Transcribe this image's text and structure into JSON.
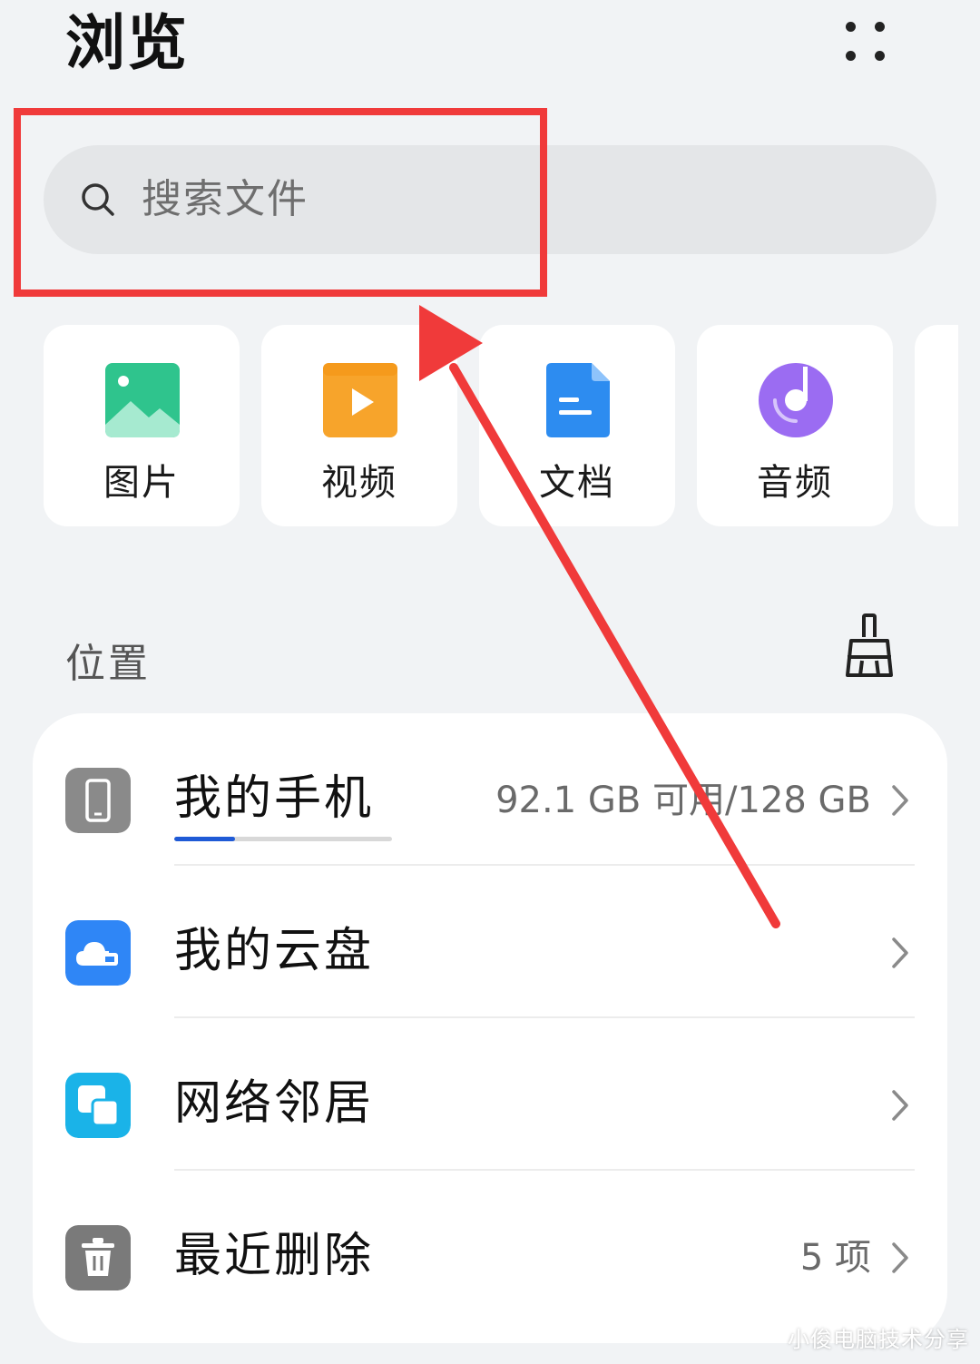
{
  "header": {
    "title": "浏览",
    "more_icon": "more-dots-icon"
  },
  "search": {
    "placeholder": "搜索文件",
    "icon": "search-icon"
  },
  "categories": [
    {
      "label": "图片",
      "icon": "image-icon",
      "color": "#2fc48d"
    },
    {
      "label": "视频",
      "icon": "video-icon",
      "color": "#f7a42b"
    },
    {
      "label": "文档",
      "icon": "document-icon",
      "color": "#2d8cf0"
    },
    {
      "label": "音频",
      "icon": "audio-icon",
      "color": "#9b6cf2"
    }
  ],
  "locations": {
    "title": "位置",
    "clean_icon": "broom-icon",
    "items": [
      {
        "label": "我的手机",
        "meta": "92.1 GB 可用/128 GB",
        "icon": "phone-icon",
        "icon_color": "#8a8a8a",
        "storage_used_fraction": 0.28
      },
      {
        "label": "我的云盘",
        "meta": "",
        "icon": "cloud-icon",
        "icon_color": "#2f86f6"
      },
      {
        "label": "网络邻居",
        "meta": "",
        "icon": "network-icon",
        "icon_color": "#1ab3e8"
      },
      {
        "label": "最近删除",
        "meta": "5 项",
        "icon": "trash-icon",
        "icon_color": "#7a7a7a"
      }
    ]
  },
  "annotation": {
    "highlight_color": "#f03a3a"
  },
  "watermark": "小俊电脑技术分享"
}
